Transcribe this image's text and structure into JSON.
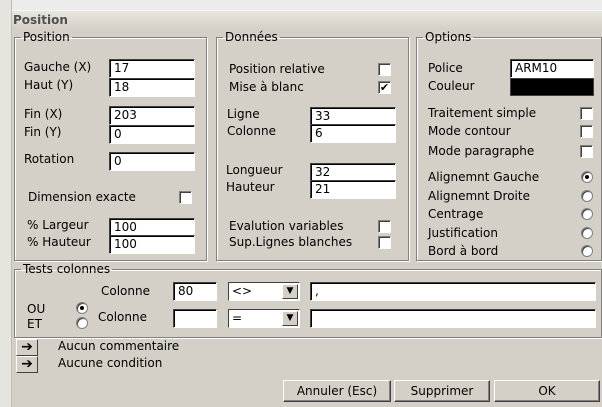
{
  "window": {
    "title": "Position"
  },
  "position": {
    "legend": "Position",
    "gauche_label": "Gauche (X)",
    "gauche_value": "17",
    "haut_label": "Haut (Y)",
    "haut_value": "18",
    "finx_label": "Fin (X)",
    "finx_value": "203",
    "finy_label": "Fin (Y)",
    "finy_value": "0",
    "rotation_label": "Rotation",
    "rotation_value": "0",
    "dimension_label": "Dimension exacte",
    "dimension_checked": false,
    "largeur_label": "% Largeur",
    "largeur_value": "100",
    "hauteur_label": "% Hauteur",
    "hauteur_value": "100"
  },
  "donnees": {
    "legend": "Données",
    "relative_label": "Position relative",
    "relative_checked": false,
    "blanc_label": "Mise à blanc",
    "blanc_checked": true,
    "ligne_label": "Ligne",
    "ligne_value": "33",
    "colonne_label": "Colonne",
    "colonne_value": "6",
    "longueur_label": "Longueur",
    "longueur_value": "32",
    "hauteur_label": "Hauteur",
    "hauteur_value": "21",
    "evalution_label": "Evalution variables",
    "evalution_checked": false,
    "suplignes_label": "Sup.Lignes blanches",
    "suplignes_checked": false
  },
  "options": {
    "legend": "Options",
    "police_label": "Police",
    "police_value": "ARM10",
    "couleur_label": "Couleur",
    "couleur_value": "#000000",
    "traitement_label": "Traitement simple",
    "contour_label": "Mode contour",
    "paragraphe_label": "Mode paragraphe",
    "align_options": [
      "Alignemnt Gauche",
      "Alignemnt Droite",
      "Centrage",
      "Justification",
      "Bord à bord"
    ],
    "align_selected": 0
  },
  "tests": {
    "legend": "Tests colonnes",
    "colonne1_label": "Colonne",
    "colonne1_value": "80",
    "op1_value": "<>",
    "val1_value": ",",
    "ou_label": "OU",
    "et_label": "ET",
    "logic_selected": "OU",
    "colonne2_label": "Colonne",
    "colonne2_value": "",
    "op2_value": "=",
    "val2_value": ""
  },
  "notes": {
    "comment": "Aucun commentaire",
    "condition": "Aucune condition"
  },
  "buttons": {
    "cancel": "Annuler (Esc)",
    "delete": "Supprimer",
    "ok": "OK"
  }
}
